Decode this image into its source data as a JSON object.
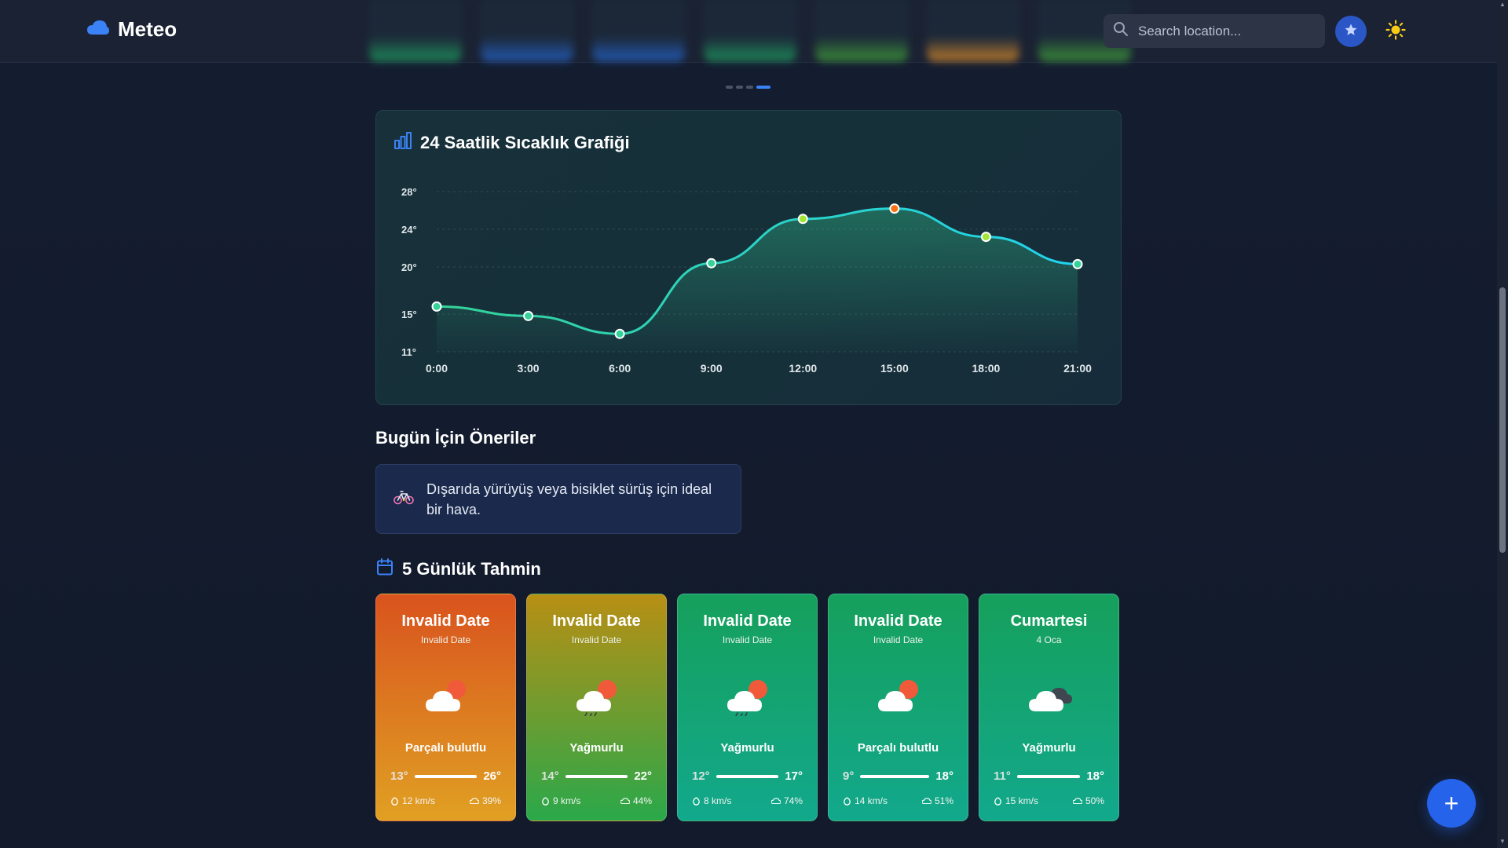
{
  "app": {
    "name": "Meteo"
  },
  "header": {
    "search_placeholder": "Search location...",
    "strip_colors": [
      "#1e9a5e",
      "#2563c7",
      "#2563c7",
      "#1e9a5e",
      "#3f9d3a",
      "#d4882a",
      "#3f9d3a"
    ]
  },
  "carousel": {
    "pages": 4,
    "active": 3
  },
  "chart_section": {
    "title": "24 Saatlik Sıcaklık Grafiği"
  },
  "chart_data": {
    "type": "line",
    "title": "24 Saatlik Sıcaklık Grafiği",
    "x": [
      "0:00",
      "3:00",
      "6:00",
      "9:00",
      "12:00",
      "15:00",
      "18:00",
      "21:00"
    ],
    "values": [
      15.8,
      14.8,
      12.9,
      20.4,
      25.1,
      26.2,
      23.2,
      20.3
    ],
    "yticks": [
      "28°",
      "24°",
      "20°",
      "15°",
      "11°"
    ],
    "ylim": [
      11,
      28
    ],
    "grid": true,
    "point_colors": [
      "#34d399",
      "#34d399",
      "#34d399",
      "#34d399",
      "#a3e635",
      "#f97316",
      "#a3e635",
      "#34d399"
    ],
    "line_colors": [
      "#34d399",
      "#22d3ee"
    ]
  },
  "recommendations": {
    "title": "Bugün İçin Öneriler",
    "items": [
      {
        "icon": "bicycle-icon",
        "text": "Dışarıda yürüyüş veya bisiklet sürüş için ideal bir hava."
      }
    ]
  },
  "forecast": {
    "title": "5 Günlük Tahmin",
    "days": [
      {
        "day": "Invalid Date",
        "date": "Invalid Date",
        "icon": "partly-cloudy-icon",
        "condition": "Parçalı bulutlu",
        "low": "13°",
        "high": "26°",
        "wind": "12 km/s",
        "humidity": "39%",
        "gradient": [
          "#d9531e",
          "#e0a023"
        ]
      },
      {
        "day": "Invalid Date",
        "date": "Invalid Date",
        "icon": "rain-icon",
        "condition": "Yağmurlu",
        "low": "14°",
        "high": "22°",
        "wind": "9 km/s",
        "humidity": "44%",
        "gradient": [
          "#b88f14",
          "#2aa84a"
        ]
      },
      {
        "day": "Invalid Date",
        "date": "Invalid Date",
        "icon": "rain-icon",
        "condition": "Yağmurlu",
        "low": "12°",
        "high": "17°",
        "wind": "8 km/s",
        "humidity": "74%",
        "gradient": [
          "#16a05c",
          "#12a88c"
        ]
      },
      {
        "day": "Invalid Date",
        "date": "Invalid Date",
        "icon": "partly-cloudy-icon",
        "condition": "Parçalı bulutlu",
        "low": "9°",
        "high": "18°",
        "wind": "14 km/s",
        "humidity": "51%",
        "gradient": [
          "#16a05c",
          "#12a88c"
        ]
      },
      {
        "day": "Cumartesi",
        "date": "4 Oca",
        "icon": "cloudy-rain-icon",
        "condition": "Yağmurlu",
        "low": "11°",
        "high": "18°",
        "wind": "15 km/s",
        "humidity": "50%",
        "gradient": [
          "#16a05c",
          "#12a88c"
        ]
      }
    ]
  },
  "fab": {
    "label": "+"
  }
}
